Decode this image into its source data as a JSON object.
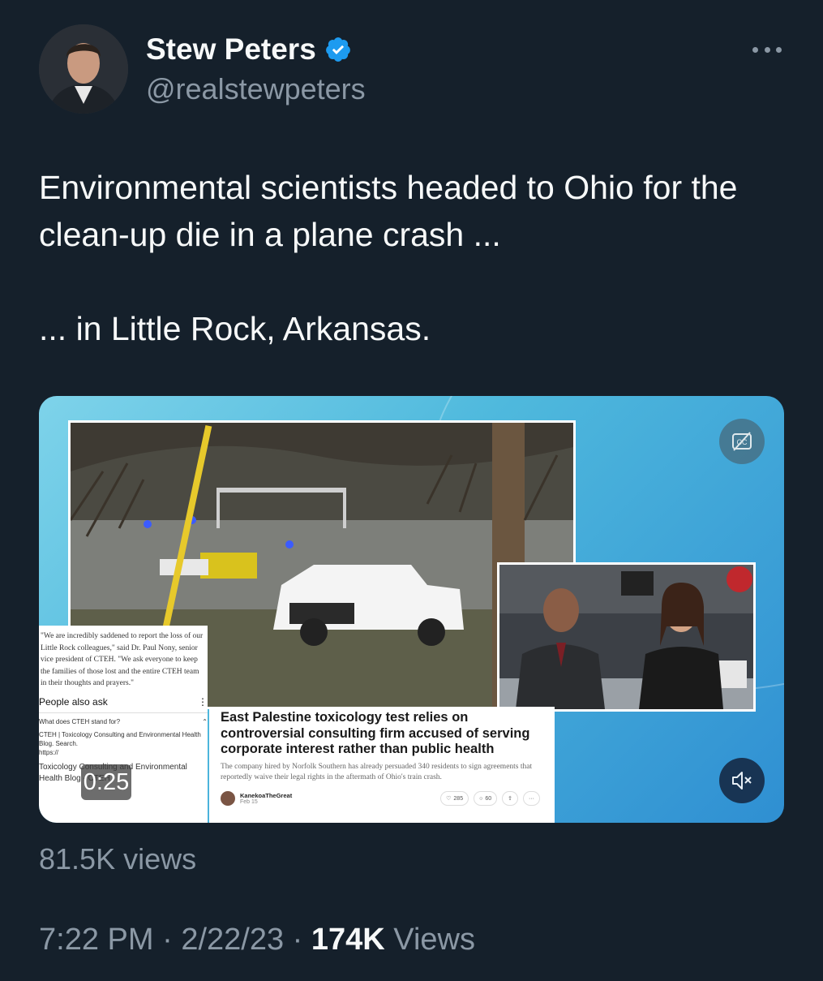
{
  "author": {
    "name": "Stew Peters",
    "handle": "@realstewpeters",
    "verified": true
  },
  "tweet": {
    "line1": "Environmental scientists headed to Ohio for the clean-up die in a plane crash ...",
    "line2": "... in Little Rock, Arkansas."
  },
  "video": {
    "timer": "0:25",
    "left_card": {
      "quote": "\"We are incredibly saddened to report the loss of our Little Rock colleagues,\" said Dr. Paul Nony, senior vice president of CTEH. \"We ask everyone to keep the families of those lost and the entire CTEH team in their thoughts and prayers.\"",
      "people_also_ask": "People also ask",
      "question": "What does CTEH stand for?",
      "result_title": "CTEH | Toxicology Consulting and Environmental Health Blog. Search.",
      "result_url": "https://",
      "result_link": "Toxicology Consulting and Environmental Health Blog - CTEH"
    },
    "article": {
      "headline": "East Palestine toxicology test relies on controversial consulting firm accused of serving corporate interest rather than public health",
      "subtext": "The company hired by Norfolk Southern has already persuaded 340 residents to sign agreements that reportedly waive their legal rights in the aftermath of Ohio's train crash.",
      "author": "KanekoaTheGreat",
      "date": "Feb 15",
      "likes": "285",
      "comments": "60"
    }
  },
  "stats": {
    "views": "81.5K views",
    "time": "7:22 PM",
    "date": "2/22/23",
    "view_count": "174K",
    "view_label": "Views"
  },
  "colors": {
    "background": "#15202b",
    "text": "#e7e9ea",
    "secondary": "#8b98a5",
    "verified": "#1d9bf0"
  }
}
